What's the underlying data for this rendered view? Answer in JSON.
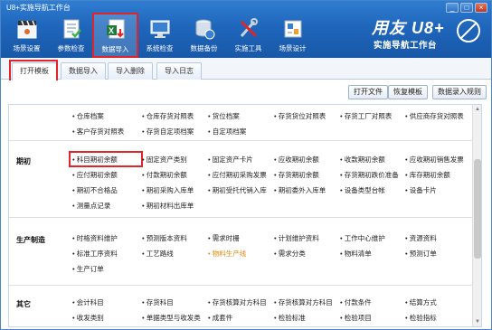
{
  "window": {
    "title": "U8+实施导航工作台",
    "buttons": [
      "_",
      "□",
      "×"
    ]
  },
  "toolbar": [
    {
      "label": "场景设置",
      "icon": "clapperboard-icon",
      "active": false
    },
    {
      "label": "参数检查",
      "icon": "checklist-icon",
      "active": false
    },
    {
      "label": "数据导入",
      "icon": "excel-import-icon",
      "active": true
    },
    {
      "label": "系统检查",
      "icon": "monitor-icon",
      "active": false
    },
    {
      "label": "数据备份",
      "icon": "database-icon",
      "active": false
    },
    {
      "label": "实施工具",
      "icon": "tools-icon",
      "active": false
    },
    {
      "label": "场景设计",
      "icon": "scene-design-icon",
      "active": false
    }
  ],
  "brand": {
    "name": "用友 U8+",
    "tagline": "实施导航工作台"
  },
  "tabs": [
    "打开模板",
    "数据导入",
    "导入删除",
    "导入日志"
  ],
  "actions": [
    "打开文件",
    "恢复模板",
    "数据录入规则"
  ],
  "sections": [
    {
      "label": "",
      "items": [
        "仓库档案",
        "仓库存货对照表",
        "货位档案",
        "存货货位对照表",
        "存货工厂对照表",
        "供应商存货对照表",
        "客户存货对照表",
        "存货自定项档案",
        "自定项档案"
      ]
    },
    {
      "label": "期初",
      "items": [
        "科目期初余额",
        "固定资产类别",
        "固定资产卡片",
        "应收期初余额",
        "收款期初余额",
        "应收期初销售发票",
        "应付期初余额",
        "付款期初余额",
        "应付期初采购发票",
        "存货期初余额",
        "存货期初跌价准备",
        "库存期初余额",
        "期初不合格品",
        "期初采购入库单",
        "期初受托代销入库",
        "期初委外入库单",
        "设备类型台帐",
        "设备卡片",
        "测量点记录",
        "期初材料出库单"
      ]
    },
    {
      "label": "生产制造",
      "items": [
        "时格资料维护",
        "预测版本资料",
        "需求时栅",
        "计划维护资料",
        "工作中心维护",
        "资源资料",
        "标准工序资料",
        "工艺路线",
        "物料生产线",
        "需求分类",
        "物料清单",
        "预测订单",
        "生产订单"
      ]
    },
    {
      "label": "其它",
      "items": [
        "会计科目",
        "存货科目",
        "存货核算对方科目",
        "存货核算对方科目",
        "付款条件",
        "结算方式",
        "收发类别",
        "单据类型与收发类",
        "成套件",
        "检验标准",
        "检验项目",
        "检验指标"
      ]
    }
  ]
}
